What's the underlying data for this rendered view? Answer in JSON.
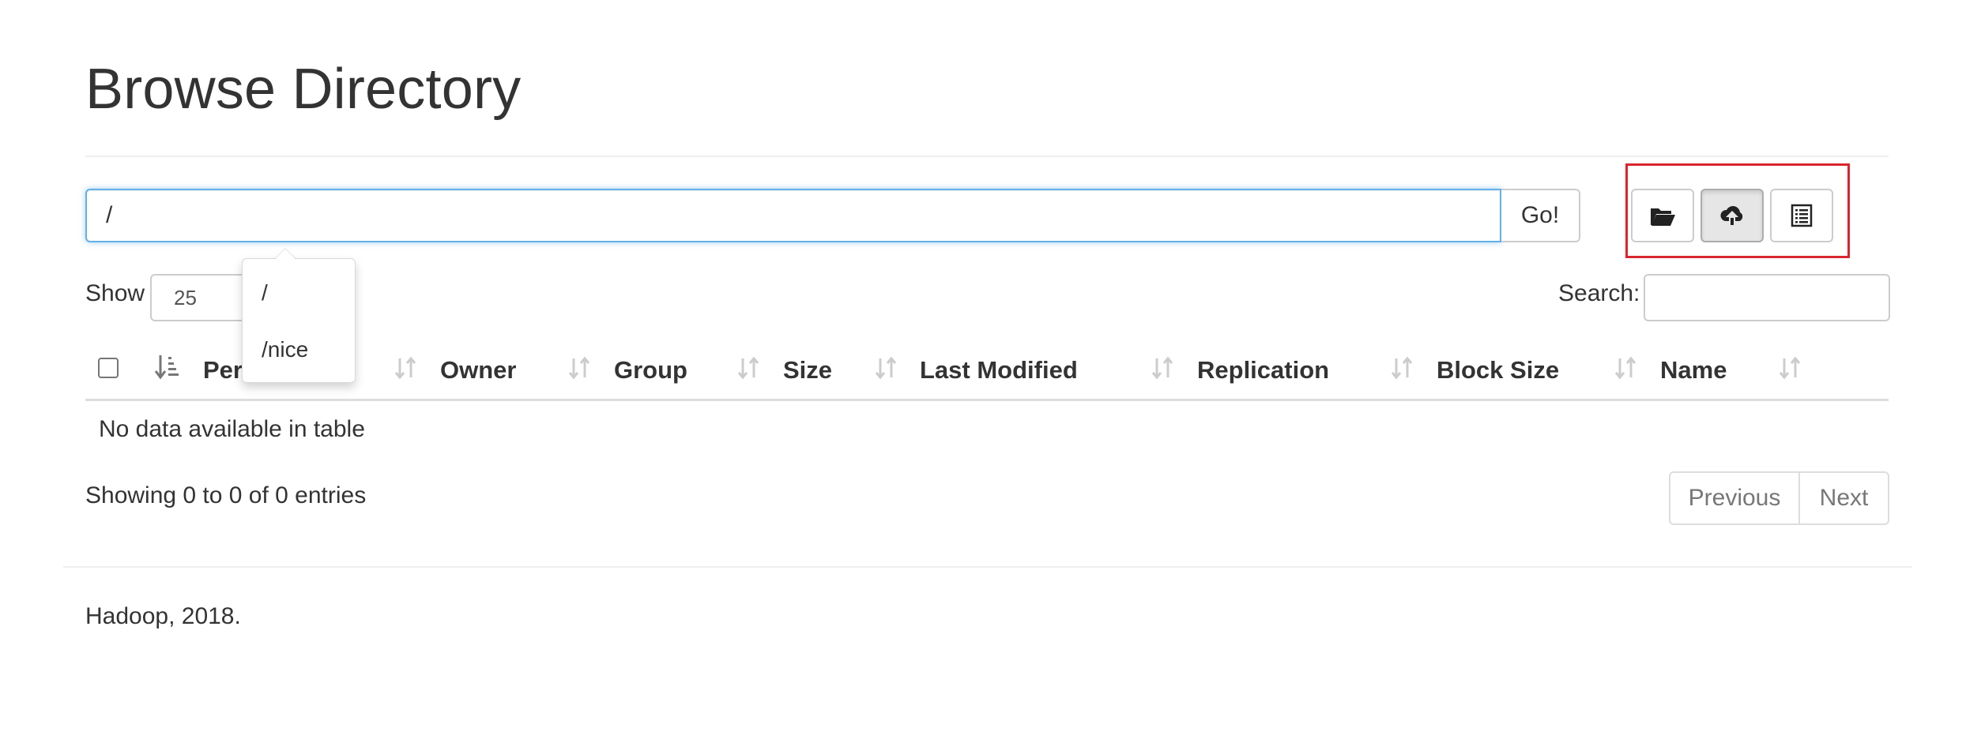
{
  "page": {
    "title": "Browse Directory"
  },
  "path_bar": {
    "value": "/",
    "go_label": "Go!"
  },
  "toolbar": {
    "buttons": [
      {
        "name": "create-directory",
        "icon": "folder-open-icon",
        "active": false
      },
      {
        "name": "upload",
        "icon": "cloud-upload-icon",
        "active": true
      },
      {
        "name": "cut-paste",
        "icon": "list-icon",
        "active": false
      }
    ],
    "highlight_color": "#d9252e"
  },
  "table_controls": {
    "show_label": "Show",
    "show_value": "25",
    "search_label": "Search:",
    "search_value": ""
  },
  "table": {
    "columns": [
      "Permission",
      "Owner",
      "Group",
      "Size",
      "Last Modified",
      "Replication",
      "Block Size",
      "Name"
    ],
    "empty_message": "No data available in table",
    "info": "Showing 0 to 0 of 0 entries"
  },
  "pagination": {
    "previous": "Previous",
    "next": "Next"
  },
  "autocomplete": {
    "items": [
      "/",
      "/nice"
    ]
  },
  "footer": {
    "text": "Hadoop, 2018."
  }
}
